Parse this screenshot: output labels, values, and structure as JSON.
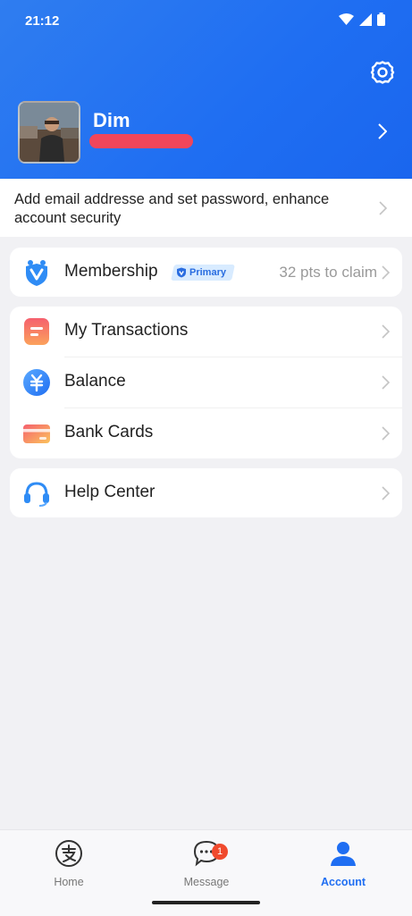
{
  "status_bar": {
    "time": "21:12"
  },
  "header": {
    "username": "Dim"
  },
  "security_prompt": {
    "text": "Add email addresse and set password, enhance account security"
  },
  "membership": {
    "label": "Membership",
    "badge": "Primary",
    "points_text": "32 pts to claim"
  },
  "menu": {
    "items": [
      {
        "label": "My Transactions",
        "icon": "transactions-icon"
      },
      {
        "label": "Balance",
        "icon": "balance-yuan-icon"
      },
      {
        "label": "Bank Cards",
        "icon": "bank-card-icon"
      }
    ]
  },
  "help": {
    "label": "Help Center"
  },
  "tabbar": {
    "tabs": [
      {
        "label": "Home"
      },
      {
        "label": "Message",
        "badge": "1"
      },
      {
        "label": "Account",
        "active": true
      }
    ]
  },
  "colors": {
    "brand": "#1f6ef2",
    "notification": "#f04a2d",
    "redaction": "#f0465b"
  }
}
